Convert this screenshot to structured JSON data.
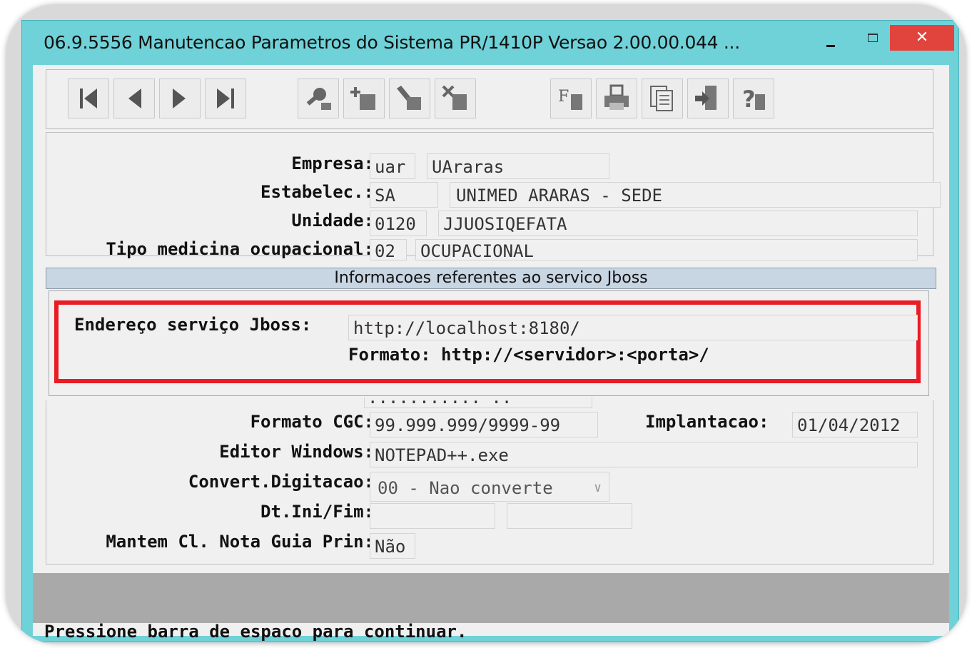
{
  "window": {
    "title": "06.9.5556 Manutencao  Parametros do Sistema PR/1410P Versao 2.00.00.044 ...",
    "close_glyph": "✕"
  },
  "toolbar": {
    "buttons": [
      "first-record-icon",
      "previous-record-icon",
      "next-record-icon",
      "last-record-icon",
      "search-icon",
      "add-record-icon",
      "edit-record-icon",
      "delete-record-icon",
      "filter-icon",
      "print-icon",
      "copy-icon",
      "exit-icon",
      "help-icon"
    ]
  },
  "form": {
    "empresa": {
      "label": "Empresa:",
      "code": "uar",
      "name": "UAraras"
    },
    "estabelec": {
      "label": "Estabelec.:",
      "code": "SA",
      "name": "UNIMED ARARAS - SEDE"
    },
    "unidade": {
      "label": "Unidade:",
      "code": "0120",
      "name": "JJUOSIQEFATA"
    },
    "tipo_medicina": {
      "label": "Tipo medicina ocupacional:",
      "code": "02",
      "name": "OCUPACIONAL"
    }
  },
  "jboss": {
    "section_title": "Informacoes referentes ao servico Jboss",
    "address_label": "Endereço serviço Jboss:",
    "address_value": "http://localhost:8180/",
    "format_hint": "Formato: http://<servidor>:<porta>/"
  },
  "form2": {
    "hidden_peek": "........... ..",
    "formato_cgc": {
      "label": "Formato CGC:",
      "value": "99.999.999/9999-99"
    },
    "implantacao": {
      "label": "Implantacao:",
      "value": "01/04/2012"
    },
    "editor_windows": {
      "label": "Editor Windows:",
      "value": "NOTEPAD++.exe"
    },
    "convert_digitacao": {
      "label": "Convert.Digitacao:",
      "value": "00 - Nao converte",
      "chevron": "∨"
    },
    "dt_ini_fim": {
      "label": "Dt.Ini/Fim:",
      "ini": "",
      "fim": ""
    },
    "mantem_cl": {
      "label": "Mantem Cl. Nota Guia Prin:",
      "value": "Não"
    }
  },
  "status_bar": {
    "text": "Pressione barra de espaco para continuar."
  },
  "colors": {
    "window_frame": "#6fd2d8",
    "highlight_box": "#e81c24",
    "section_band": "#c8d5e3",
    "close_button": "#e0443c"
  }
}
